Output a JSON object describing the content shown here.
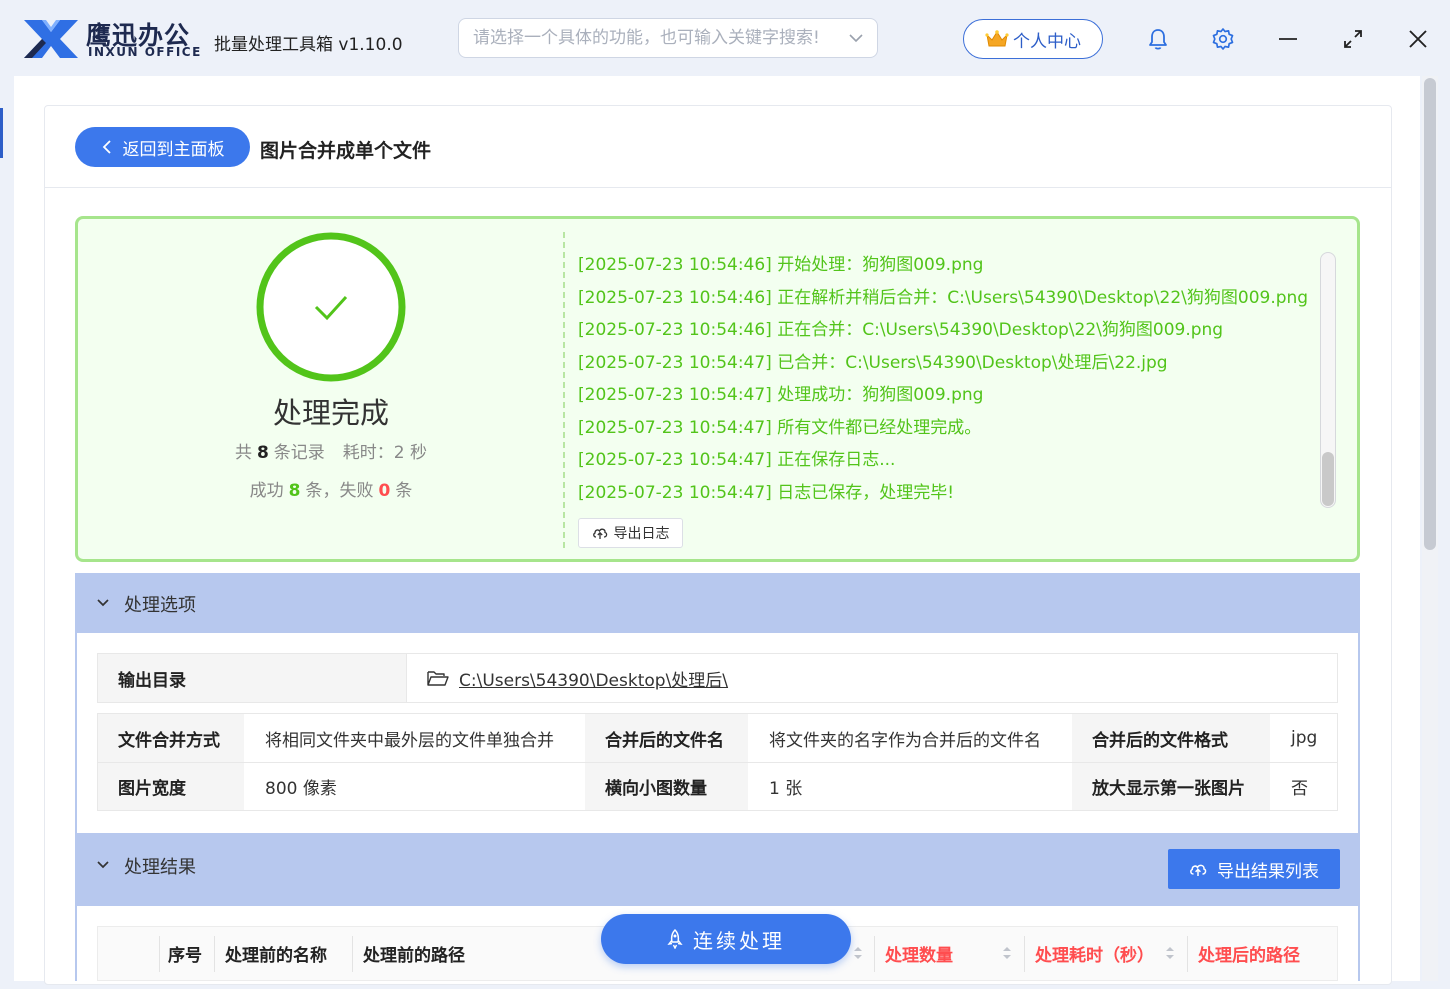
{
  "app": {
    "brand_cn": "鹰迅办公",
    "brand_en": "INXUN OFFICE",
    "title": "批量处理工具箱 v1.10.0",
    "search_placeholder": "请选择一个具体的功能，也可输入关键字搜索!",
    "user_center": "个人中心",
    "accent_color": "#3c78ec"
  },
  "header": {
    "back_label": "返回到主面板",
    "page_title": "图片合并成单个文件"
  },
  "result": {
    "status": "处理完成",
    "total_prefix": "共",
    "total_count": "8",
    "total_suffix": "条记录",
    "time_label": "耗时：2 秒",
    "success_prefix": "成功",
    "success_count": "8",
    "success_suffix": "条，失败",
    "fail_count": "0",
    "fail_suffix": "条",
    "logs": [
      "[2025-07-23 10:54:46] 开始处理：狗狗图009.png",
      "[2025-07-23 10:54:46] 正在解析并稍后合并：C:\\Users\\54390\\Desktop\\22\\狗狗图009.png",
      "[2025-07-23 10:54:46] 正在合并：C:\\Users\\54390\\Desktop\\22\\狗狗图009.png",
      "[2025-07-23 10:54:47] 已合并：C:\\Users\\54390\\Desktop\\处理后\\22.jpg",
      "[2025-07-23 10:54:47] 处理成功：狗狗图009.png",
      "[2025-07-23 10:54:47] 所有文件都已经处理完成。",
      "[2025-07-23 10:54:47] 正在保存日志...",
      "[2025-07-23 10:54:47] 日志已保存，处理完毕!"
    ],
    "export_log": "导出日志"
  },
  "options": {
    "section_title": "处理选项",
    "output_dir_label": "输出目录",
    "output_dir_value": "C:\\Users\\54390\\Desktop\\处理后\\",
    "merge_mode_label": "文件合并方式",
    "merge_mode_value": "将相同文件夹中最外层的文件单独合并",
    "merged_name_label": "合并后的文件名",
    "merged_name_value": "将文件夹的名字作为合并后的文件名",
    "merged_format_label": "合并后的文件格式",
    "merged_format_value": "jpg",
    "image_width_label": "图片宽度",
    "image_width_value": "800 像素",
    "horizontal_count_label": "横向小图数量",
    "horizontal_count_value": "1 张",
    "enlarge_first_label": "放大显示第一张图片",
    "enlarge_first_value": "否"
  },
  "results": {
    "section_title": "处理结果",
    "export_list": "导出结果列表",
    "columns": {
      "index": "序号",
      "name_before": "处理前的名称",
      "path_before": "处理前的路径",
      "count": "处理数量",
      "time_cost": "处理耗时（秒）",
      "path_after": "处理后的路径"
    }
  },
  "continue_label": "连续处理"
}
